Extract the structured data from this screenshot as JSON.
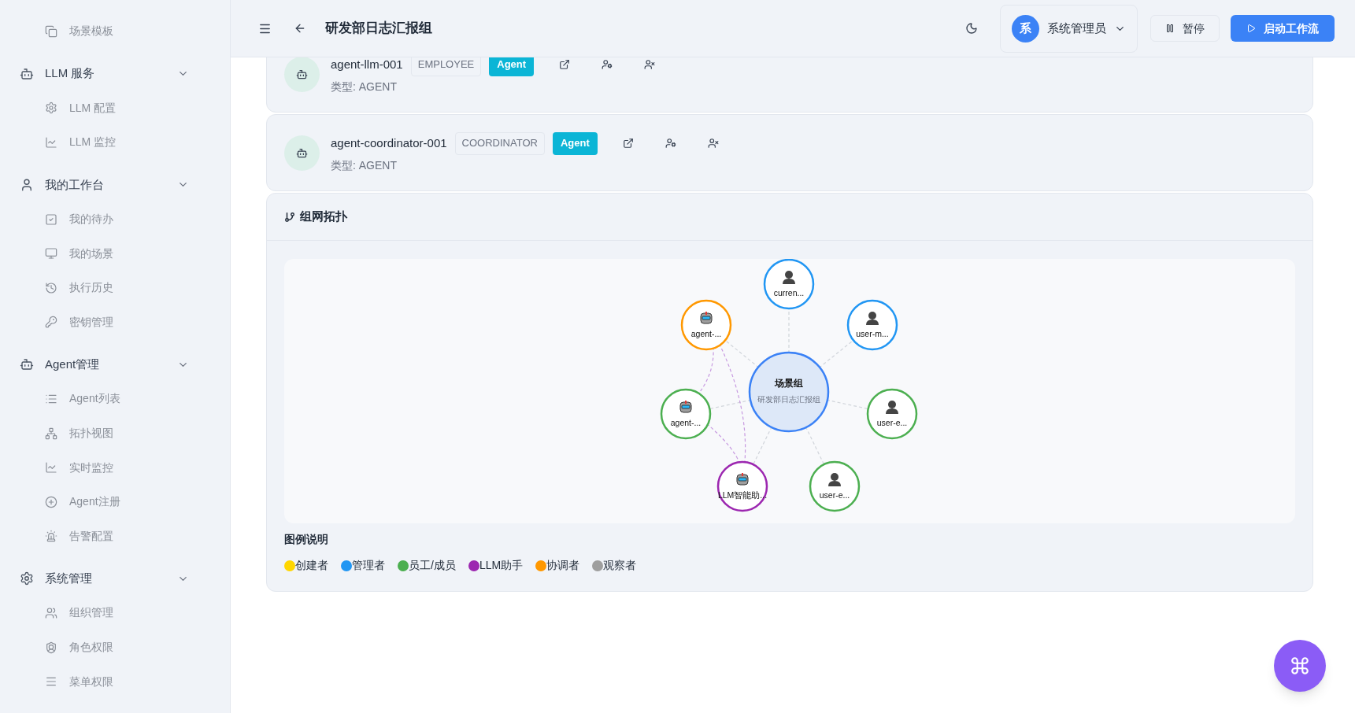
{
  "sidebar": {
    "top_items": [
      {
        "label": "场景模板",
        "selected": false
      }
    ],
    "groups": [
      {
        "label": "LLM 服务",
        "expanded": true,
        "items": [
          {
            "label": "LLM 配置",
            "selected": false
          },
          {
            "label": "LLM 监控",
            "selected": false
          }
        ]
      },
      {
        "label": "我的工作台",
        "expanded": true,
        "items": [
          {
            "label": "我的待办",
            "selected": false
          },
          {
            "label": "我的场景",
            "selected": false
          },
          {
            "label": "执行历史",
            "selected": false
          },
          {
            "label": "密钥管理",
            "selected": false
          }
        ]
      },
      {
        "label": "Agent管理",
        "expanded": true,
        "items": [
          {
            "label": "Agent列表",
            "selected": false
          },
          {
            "label": "拓扑视图",
            "selected": false
          },
          {
            "label": "实时监控",
            "selected": false
          },
          {
            "label": "Agent注册",
            "selected": false
          },
          {
            "label": "告警配置",
            "selected": false
          }
        ]
      },
      {
        "label": "系统管理",
        "expanded": true,
        "items": [
          {
            "label": "组织管理",
            "selected": false
          },
          {
            "label": "角色权限",
            "selected": false
          },
          {
            "label": "菜单权限",
            "selected": false
          }
        ]
      }
    ]
  },
  "header": {
    "title": "研发部日志汇报组",
    "user": {
      "avatar": "系",
      "name": "系统管理员"
    },
    "pause_button": "暂停",
    "start_button": "启动工作流"
  },
  "members": [
    {
      "name": "agent-llm-001",
      "role": "EMPLOYEE",
      "badge": "Agent",
      "type": "类型: AGENT"
    },
    {
      "name": "agent-coordinator-001",
      "role": "COORDINATOR",
      "badge": "Agent",
      "type": "类型: AGENT"
    }
  ],
  "topology": {
    "title": "组网拓扑",
    "center": {
      "title": "场景组",
      "subtitle": "研发部日志汇报组"
    },
    "nodes": [
      {
        "label": "curren...",
        "kind": "user",
        "color": "#2196f3"
      },
      {
        "label": "user-m...",
        "kind": "user",
        "color": "#2196f3"
      },
      {
        "label": "user-e...",
        "kind": "user",
        "color": "#4caf50"
      },
      {
        "label": "user-e...",
        "kind": "user",
        "color": "#4caf50"
      },
      {
        "label": "LLM智能助...",
        "kind": "agent",
        "color": "#9c27b0"
      },
      {
        "label": "agent-...",
        "kind": "agent",
        "color": "#4caf50"
      },
      {
        "label": "agent-...",
        "kind": "agent",
        "color": "#ff9800"
      }
    ],
    "legend_title": "图例说明",
    "legend": [
      {
        "label": "创建者",
        "color": "#ffd600"
      },
      {
        "label": "管理者",
        "color": "#2196f3"
      },
      {
        "label": "员工/成员",
        "color": "#4caf50"
      },
      {
        "label": "LLM助手",
        "color": "#9c27b0"
      },
      {
        "label": "协调者",
        "color": "#ff9800"
      },
      {
        "label": "观察者",
        "color": "#9e9e9e"
      }
    ]
  }
}
